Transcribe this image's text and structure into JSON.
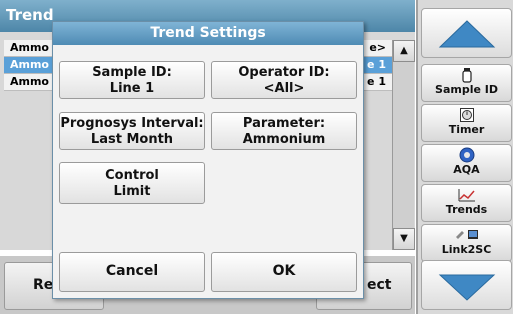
{
  "app": {
    "title": "Trend",
    "rows": [
      {
        "lead": "Ammo",
        "tail": "e>"
      },
      {
        "lead": "Ammo",
        "tail": "e 1"
      },
      {
        "lead": "Ammo",
        "tail": "e 1"
      }
    ],
    "bottom_left_label": "Re",
    "bottom_right_label": "ect"
  },
  "sidebar": {
    "buttons": [
      {
        "label": "Sample ID",
        "icon": "sample-bottle-icon"
      },
      {
        "label": "Timer",
        "icon": "timer-icon"
      },
      {
        "label": "AQA",
        "icon": "aqa-icon"
      },
      {
        "label": "Trends",
        "icon": "trends-icon"
      },
      {
        "label": "Link2SC",
        "icon": "link2sc-icon"
      }
    ]
  },
  "dialog": {
    "title": "Trend Settings",
    "sample_id": {
      "label": "Sample ID:",
      "value": "Line 1"
    },
    "operator_id": {
      "label": "Operator ID:",
      "value": "<All>"
    },
    "prognosys": {
      "label": "Prognosys Interval:",
      "value": "Last Month"
    },
    "parameter": {
      "label": "Parameter:",
      "value": "Ammonium"
    },
    "control_limit": {
      "line1": "Control",
      "line2": "Limit"
    },
    "cancel_label": "Cancel",
    "ok_label": "OK"
  },
  "colors": {
    "title_bar": "#4f8bb4",
    "selected_row": "#5aa0d8",
    "arrow_blue": "#3f88c4"
  }
}
